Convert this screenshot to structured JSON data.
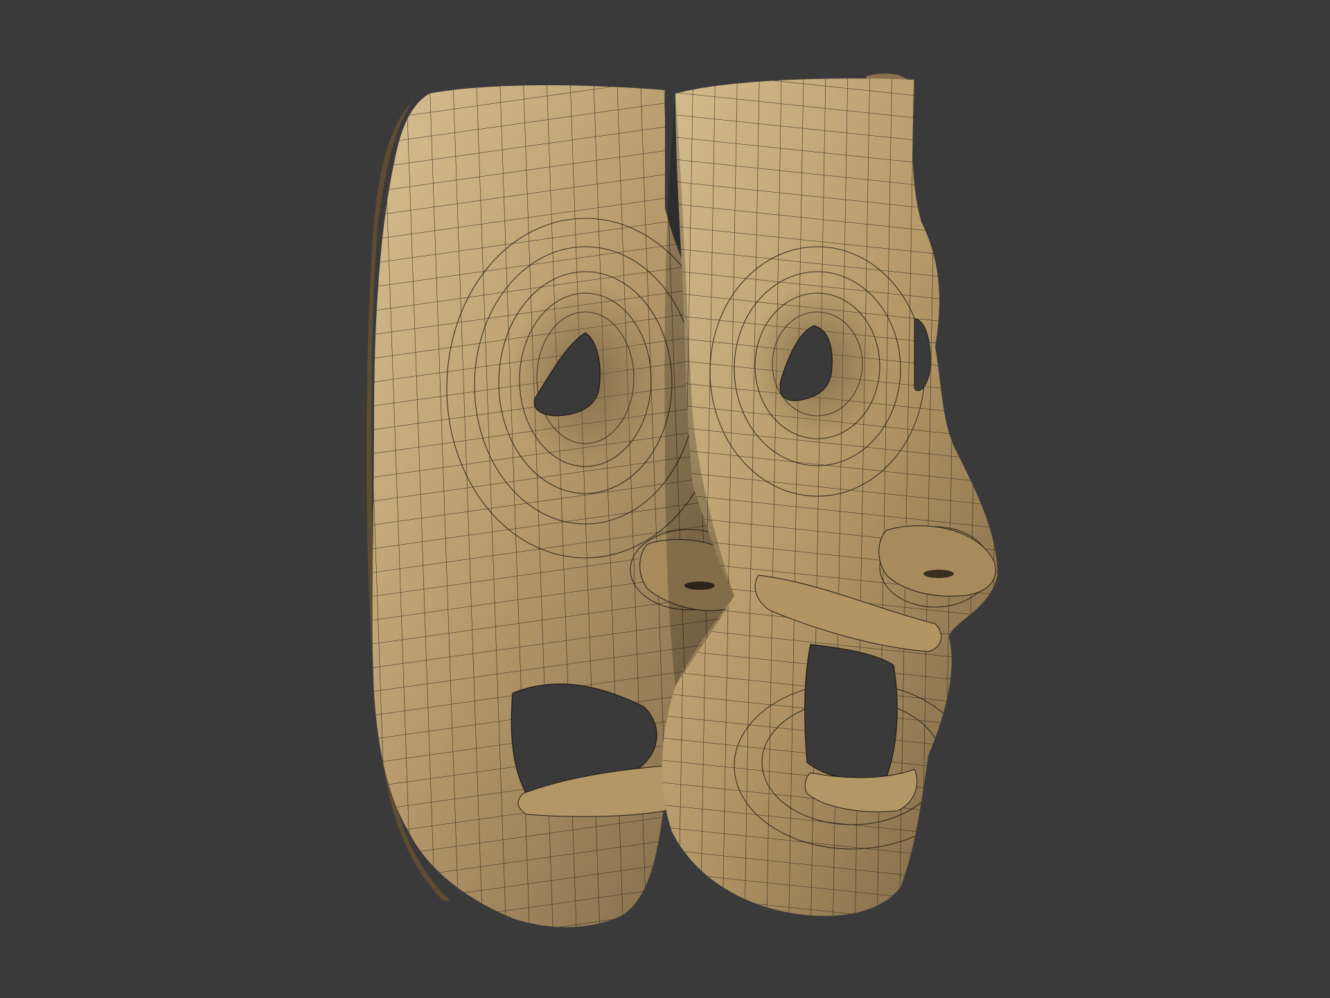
{
  "scene": {
    "background_color": "#3a3a3a",
    "mesh_color": "#b89a6d",
    "mesh_highlight": "#d6bd8e",
    "mesh_shadow": "#6e5a3c",
    "wire_color": "#1e1a14",
    "hole_color": "#3a3a3a",
    "objects": [
      "comedy-mask-mesh",
      "tragedy-mask-mesh"
    ]
  }
}
